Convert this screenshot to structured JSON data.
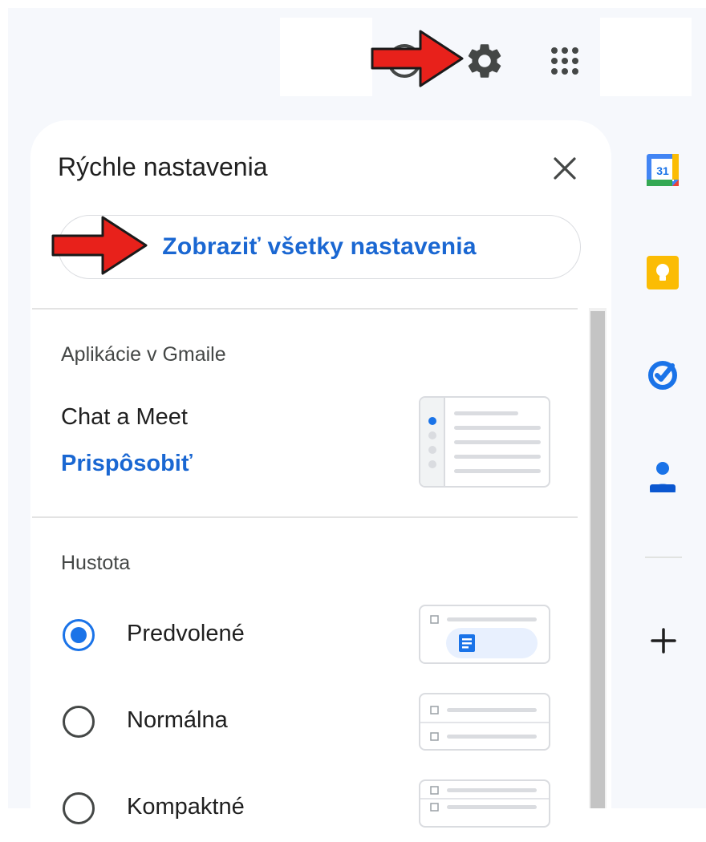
{
  "topbar": {
    "icons": [
      "help-icon",
      "gear-icon",
      "apps-grid-icon"
    ]
  },
  "quick_settings": {
    "title": "Rýchle nastavenia",
    "see_all_label": "Zobraziť všetky nastavenia",
    "apps_section": {
      "heading": "Aplikácie v Gmaile",
      "item_label": "Chat a Meet",
      "customize_link": "Prispôsobiť"
    },
    "density_section": {
      "heading": "Hustota",
      "options": [
        {
          "label": "Predvolené",
          "selected": true
        },
        {
          "label": "Normálna",
          "selected": false
        },
        {
          "label": "Kompaktné",
          "selected": false
        }
      ]
    }
  },
  "side_panel": {
    "calendar_day": "31",
    "icons": [
      "calendar-icon",
      "keep-icon",
      "tasks-icon",
      "contacts-icon",
      "add-icon"
    ]
  },
  "colors": {
    "accent_blue": "#1a67d2",
    "radio_selected": "#1a73e8",
    "arrow_red": "#e8211b",
    "app_background": "#f6f8fc"
  }
}
